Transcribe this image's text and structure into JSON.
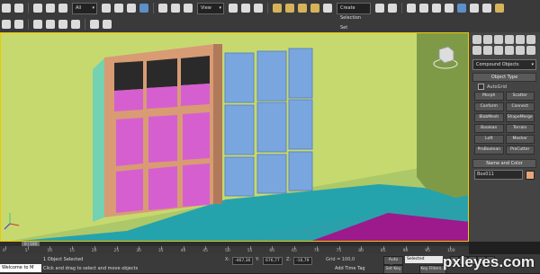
{
  "toolbar": {
    "selection_filter": "All",
    "ref_coord_system": "View",
    "named_selection_placeholder": "Create Selection Set"
  },
  "command_panel": {
    "category_dropdown": "Compound Objects",
    "object_type_title": "Object Type",
    "autogrid_label": "AutoGrid",
    "buttons": [
      "Morph",
      "Scatter",
      "Conform",
      "Connect",
      "BlobMesh",
      "ShapeMerge",
      "Boolean",
      "Terrain",
      "Loft",
      "Mesher",
      "ProBoolean",
      "ProCutter"
    ],
    "name_color_title": "Name and Color",
    "object_name": "Box011",
    "object_color": "#e8a57a"
  },
  "timeline": {
    "frame_display": "0 / 100",
    "ticks": [
      "0",
      "5",
      "10",
      "15",
      "20",
      "25",
      "30",
      "35",
      "40",
      "45",
      "50",
      "55",
      "60",
      "65",
      "70",
      "75",
      "80",
      "85",
      "90",
      "95",
      "100"
    ]
  },
  "status_bar": {
    "listener": "Welcome to M",
    "selection_status": "1 Object Selected",
    "prompt": "Click and drag to select and move objects",
    "x_label": "X:",
    "x_value": "-467,36",
    "y_label": "Y:",
    "y_value": "676,77",
    "z_label": "Z:",
    "z_value": "-16,79",
    "grid": "Grid = 100,0",
    "add_time_tag": "Add Time Tag",
    "auto_key": "Auto Key",
    "set_key": "Set Key",
    "key_mode": "Selected",
    "key_filters": "Key Filters..."
  },
  "watermark": "pxleyes.com"
}
